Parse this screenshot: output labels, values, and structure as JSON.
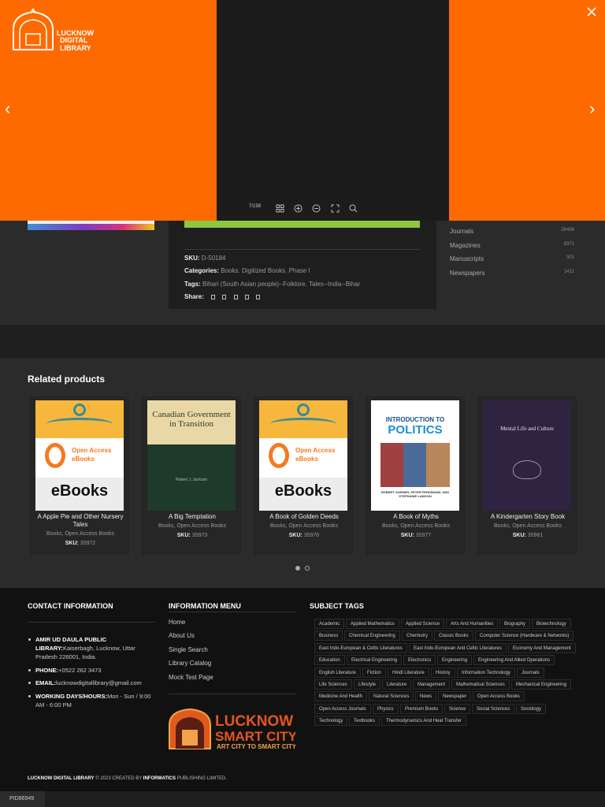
{
  "lightbox": {
    "counter": "7/158",
    "logo_line1": "LUCKNOW",
    "logo_line2": "DIGITAL LIBRARY"
  },
  "sidebar_counts": [
    {
      "label": "Journals",
      "count": "26496"
    },
    {
      "label": "Magazines",
      "count": "8371"
    },
    {
      "label": "Manuscripts",
      "count": "301"
    },
    {
      "label": "Newspapers",
      "count": "1411"
    }
  ],
  "product_meta": {
    "sku_label": "SKU:",
    "sku_value": "D-50184",
    "categories_label": "Categories:",
    "categories": [
      "Books",
      "Digitized Books",
      "Phase I"
    ],
    "tags_label": "Tags:",
    "tags": [
      "Bihari (South Asian people)--Folklore",
      "Tales--India--Bihar"
    ],
    "share_label": "Share:"
  },
  "related": {
    "title": "Related products",
    "open_access_text": "Open Access eBooks",
    "ebooks_text": "eBooks",
    "canada_cover_title": "Canadian Government in Transition",
    "canada_cover_author": "Robert J. Jackson",
    "politics_head": "INTRODUCTION TO",
    "politics_big": "POLITICS",
    "politics_authors": "ROBERT GARNER, PETER FERDINAND, AND STEPHANIE LAWSON",
    "mental_cover_title": "Mental Life and Culture",
    "products": [
      {
        "title": "A Apple Pie and Other Nursery Tales",
        "categories": "Books, Open Access Books",
        "sku_label": "SKU:",
        "sku": "35972"
      },
      {
        "title": "A Big Temptation",
        "categories": "Books, Open Access Books",
        "sku_label": "SKU:",
        "sku": "35973"
      },
      {
        "title": "A Book of Golden Deeds",
        "categories": "Books, Open Access Books",
        "sku_label": "SKU:",
        "sku": "35976"
      },
      {
        "title": "A Book of Myths",
        "categories": "Books, Open Access Books",
        "sku_label": "SKU:",
        "sku": "35977"
      },
      {
        "title": "A Kindergarten Story Book",
        "categories": "Books, Open Access Books",
        "sku_label": "SKU:",
        "sku": "35981"
      }
    ]
  },
  "footer": {
    "contact_title": "CONTACT INFORMATION",
    "address_label": "AMIR UD DAULA PUBLIC LIBRARY:",
    "address": "Kaiserbagh, Lucknow, Uttar Pradesh 226001, India.",
    "phone_label": "PHONE:",
    "phone": "+0522 262 3473",
    "email_label": "EMAIL:",
    "email": "lucknowdigitallibrary@gmail.com",
    "hours_label": "WORKING DAYS/HOURS:",
    "hours": "Mon - Sun / 9:00 AM - 6:00 PM",
    "menu_title": "INFORMATION MENU",
    "menu": [
      "Home",
      "About Us",
      "Single Search",
      "Library Catalog",
      "Mock Test Page"
    ],
    "smart_city_line1": "LUCKNOW",
    "smart_city_line2": "SMART CITY",
    "smart_city_line3": "ART CITY TO SMART CITY",
    "tags_title": "SUBJECT TAGS",
    "tags": [
      "Academic",
      "Applied Mathematics",
      "Applied Science",
      "Arts And Humanities",
      "Biography",
      "Biotechnology",
      "Business",
      "Chemical Engineering",
      "Chemistry",
      "Classic Books",
      "Computer Science (Hardware & Networks)",
      "East Indo-European & Celtic Literatures",
      "East Indo-European And Celtic Literatures",
      "Economy And Management",
      "Education",
      "Electrical Engineering",
      "Electronics",
      "Engineering",
      "Engineering And Allied Operations",
      "English Literature",
      "Fiction",
      "Hindi Literature",
      "History",
      "Information Technology",
      "Journals",
      "Life Sciences",
      "Lifestyle",
      "Literature",
      "Management",
      "Mathematical Sciences",
      "Mechanical Engineering",
      "Medicine And Health",
      "Natural Sciences",
      "News",
      "Newspaper",
      "Open Access Books",
      "Open Access Journals",
      "Physics",
      "Premium Books",
      "Science",
      "Social Sciences",
      "Sociology",
      "Technology",
      "Textbooks",
      "Thermodynamics And Heat Transfer"
    ],
    "copyright_brand": "LUCKNOW DIGITAL LIBRARY",
    "copyright_mid": "© 2023 CREATED BY",
    "copyright_company": "INFORMATICS",
    "copyright_end": "PUBLISHING LIMITED.",
    "pid": "PID86949"
  },
  "colors": {
    "lightbox_orange": "#ff6a00",
    "accent_green": "#8dc63f",
    "open_access_orange": "#f47b20"
  }
}
